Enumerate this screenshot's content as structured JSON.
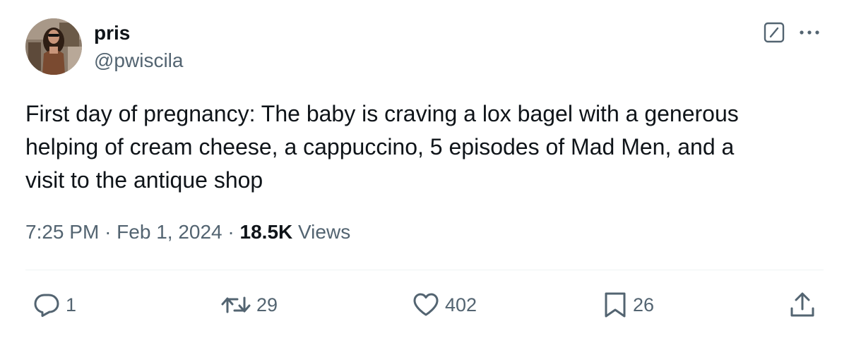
{
  "author": {
    "display_name": "pris",
    "handle": "@pwiscila"
  },
  "tweet": {
    "text": "First day of pregnancy: The baby is craving a lox bagel with a generous\nhelping of cream cheese, a cappuccino, 5 episodes of Mad Men, and a\nvisit to the antique shop",
    "time": "7:25 PM",
    "separator": "·",
    "date": "Feb 1, 2024",
    "views_count": "18.5K",
    "views_label": "Views"
  },
  "actions": {
    "replies": "1",
    "reposts": "29",
    "likes": "402",
    "bookmarks": "26"
  },
  "icons": {
    "grok": "grok-slash-icon",
    "more": "more-dots-icon",
    "reply": "reply-icon",
    "repost": "repost-icon",
    "like": "heart-icon",
    "bookmark": "bookmark-icon",
    "share": "share-icon"
  },
  "colors": {
    "text_primary": "#0f1419",
    "text_secondary": "#536471",
    "divider": "#eff3f4"
  }
}
